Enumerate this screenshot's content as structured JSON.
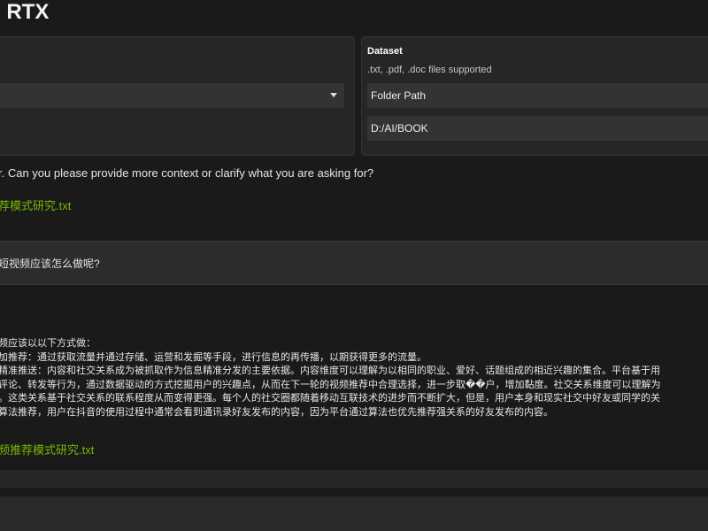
{
  "app": {
    "title": "h RTX"
  },
  "dataset": {
    "label": "Dataset",
    "hint": ".txt, .pdf, .doc files supported",
    "folder_label": "Folder Path",
    "path_value": "D:/AI/BOOK"
  },
  "chat": {
    "reply_1": "r. Can you please provide more context or clarify what you are asking for?",
    "source_1": "荐模式研究.txt",
    "question": "短视频应该怎么做呢?",
    "answer_lines": [
      "频应该以以下方式做：",
      "加推荐：通过获取流量并通过存储、运营和发掘等手段，进行信息的再传播，以期获得更多的流量。",
      "精准推送：内容和社交关系成为被抓取作为信息精准分发的主要依据。内容维度可以理解为以相同的职业、爱好、话题组成的相近兴趣的集合。平台基于用",
      "评论、转发等行为，通过数据驱动的方式挖掘用户的兴趣点，从而在下一轮的视频推荐中合理选择，进一步取��户，增加黏度。社交关系维度可以理解为",
      "。这类关系基于社交关系的联系程度从而变得更强。每个人的社交圈都随着移动互联技术的进步而不断扩大，但是，用户本身和现实社交中好友或同学的关",
      "算法推荐，用户在抖音的使用过程中通常会看到通讯录好友发布的内容，因为平台通过算法也优先推荐强关系的好友发布的内容。"
    ],
    "source_2": "频推荐模式研究.txt"
  },
  "colors": {
    "accent": "#76b900",
    "background": "#1a1a1a"
  }
}
